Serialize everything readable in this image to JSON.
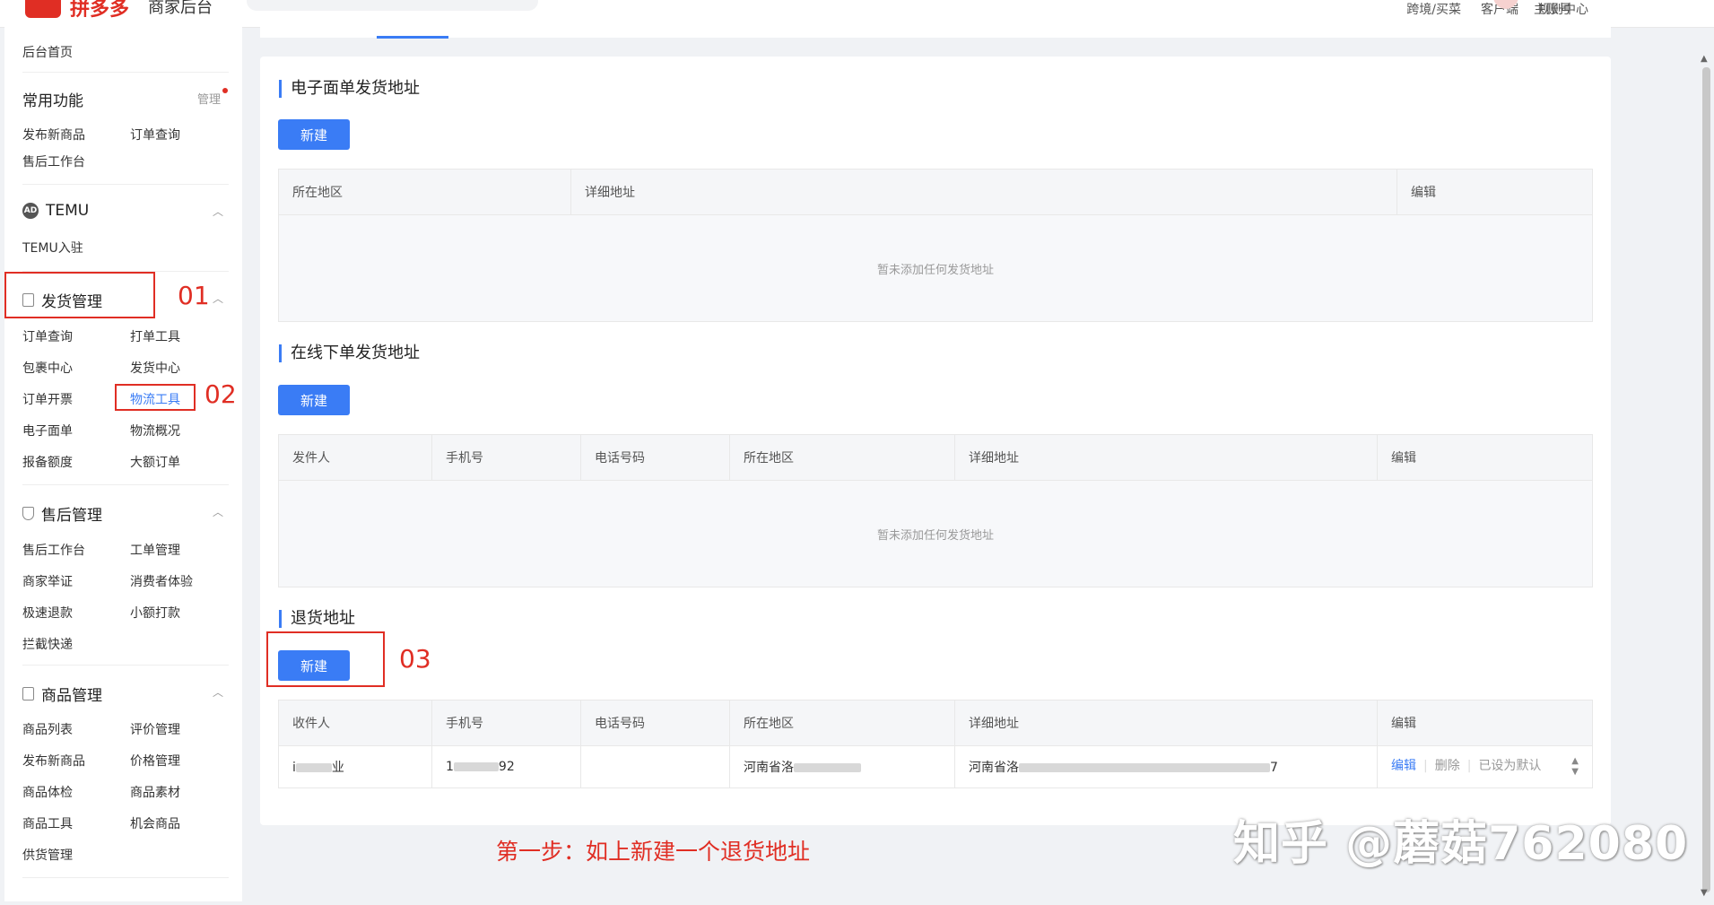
{
  "topbar": {
    "brand": "拼多多",
    "subtitle": "商家后台",
    "links": [
      "跨境/买菜",
      "客户端",
      "规则中心"
    ],
    "account": "主账号"
  },
  "sidebar": {
    "home": "后台首页",
    "common": {
      "title": "常用功能",
      "manage": "管理",
      "items": [
        "发布新商品",
        "订单查询",
        "售后工作台"
      ]
    },
    "temu": {
      "icon_text": "AD",
      "title": "TEMU",
      "items": [
        "TEMU入驻"
      ]
    },
    "shipping": {
      "title": "发货管理",
      "items": [
        "订单查询",
        "打单工具",
        "包裹中心",
        "发货中心",
        "订单开票",
        "物流工具",
        "电子面单",
        "物流概况",
        "报备额度",
        "大额订单"
      ]
    },
    "aftersale": {
      "title": "售后管理",
      "items": [
        "售后工作台",
        "工单管理",
        "商家举证",
        "消费者体验",
        "极速退款",
        "小额打款",
        "拦截快递"
      ]
    },
    "goods": {
      "title": "商品管理",
      "items": [
        "商品列表",
        "评价管理",
        "发布新商品",
        "价格管理",
        "商品体检",
        "商品素材",
        "商品工具",
        "机会商品",
        "供货管理"
      ]
    }
  },
  "main": {
    "ewaybill": {
      "title": "电子面单发货地址",
      "new_btn": "新建",
      "columns": [
        "所在地区",
        "详细地址",
        "编辑"
      ],
      "empty": "暂未添加任何发货地址"
    },
    "online": {
      "title": "在线下单发货地址",
      "new_btn": "新建",
      "columns": [
        "发件人",
        "手机号",
        "电话号码",
        "所在地区",
        "详细地址",
        "编辑"
      ],
      "empty": "暂未添加任何发货地址"
    },
    "returns": {
      "title": "退货地址",
      "new_btn": "新建",
      "columns": [
        "收件人",
        "手机号",
        "电话号码",
        "所在地区",
        "详细地址",
        "编辑"
      ],
      "row": {
        "name_start": "i",
        "name_end": "业",
        "phone_start": "1",
        "phone_end": "92",
        "tel": "",
        "region": "河南省洛",
        "detail_start": "河南省洛",
        "detail_end": "7",
        "ops": [
          "编辑",
          "删除",
          "已设为默认"
        ]
      }
    }
  },
  "annotations": {
    "step1": "01",
    "step2": "02",
    "step3": "03",
    "caption": "第一步：如上新建一个退货地址",
    "watermark": "知乎 @蘑菇762080"
  }
}
